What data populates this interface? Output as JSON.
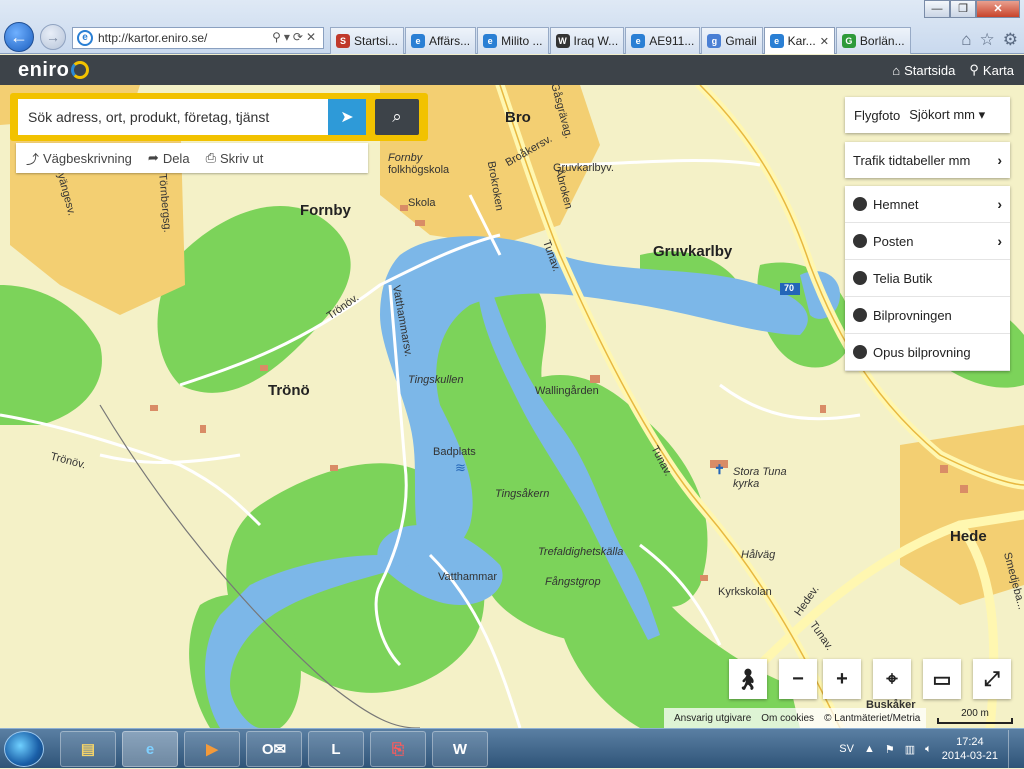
{
  "browser": {
    "url": "http://kartor.eniro.se/",
    "tabs": [
      {
        "label": "Startsi...",
        "color": "#c0392b",
        "icon": "S"
      },
      {
        "label": "Affärs...",
        "color": "#2a7fd4",
        "icon": "e"
      },
      {
        "label": "Milito ...",
        "color": "#2a7fd4",
        "icon": "e"
      },
      {
        "label": "Iraq W...",
        "color": "#333333",
        "icon": "W"
      },
      {
        "label": "AE911...",
        "color": "#2a7fd4",
        "icon": "e"
      },
      {
        "label": "Gmail",
        "color": "#4a7fd4",
        "icon": "g"
      },
      {
        "label": "Kar...",
        "color": "#2a7fd4",
        "icon": "e",
        "active": true
      },
      {
        "label": "Borlän...",
        "color": "#2e9a3a",
        "icon": "G"
      }
    ]
  },
  "eniro": {
    "logo": "eniro",
    "nav_home": "Startsida",
    "nav_map": "Karta"
  },
  "search": {
    "placeholder": "Sök adress, ort, produkt, företag, tjänst"
  },
  "actions": {
    "directions": "Vägbeskrivning",
    "share": "Dela",
    "print": "Skriv ut"
  },
  "layers": {
    "aerial": "Flygfoto",
    "chart": "Sjökort mm",
    "traffic": "Trafik tidtabeller mm"
  },
  "poi_items": [
    {
      "label": "Hemnet",
      "icon": "hemnet-icon",
      "chevron": true
    },
    {
      "label": "Posten",
      "icon": "posten-icon",
      "chevron": true
    },
    {
      "label": "Telia Butik",
      "icon": "telia-icon",
      "chevron": false
    },
    {
      "label": "Bilprovningen",
      "icon": "bilprovningen-icon",
      "chevron": false
    },
    {
      "label": "Opus bilprovning",
      "icon": "opus-icon",
      "chevron": false
    }
  ],
  "map_labels": {
    "bro": "Bro",
    "fornby": "Fornby",
    "gruvkarlby": "Gruvkarlby",
    "trono": "Trönö",
    "hede": "Hede",
    "fornby_folk": "Fornby",
    "fornby_folk2": "folkhögskola",
    "skola": "Skola",
    "tingskullen": "Tingskullen",
    "wallingarden": "Wallingården",
    "badplats": "Badplats",
    "tingsakern": "Tingsåkern",
    "trefaldighet": "Trefaldighetskälla",
    "vatthammar": "Vatthammar",
    "fangstgrop": "Fångstgrop",
    "stora_tuna": "Stora Tuna",
    "kyrka": "kyrka",
    "halvag": "Hålväg",
    "kyrkskolan": "Kyrkskolan",
    "buskaker": "Buskåker",
    "tunav1": "Tunav.",
    "tunav2": "Tunav.",
    "tunav3": "Tunav.",
    "hedev": "Hedev.",
    "vatthammarsv": "Vatthammarsv.",
    "tronov": "Trönöv.",
    "tronov2": "Trönöv.",
    "brokroken": "Brokroken",
    "abroken": "Åbroken",
    "broakersv": "Broåkersv.",
    "gasgrav": "Gåsgrävag.",
    "gruvkarlbyv": "Gruvkarlbyv.",
    "byangesv": "Byängesv.",
    "tornbergsg": "Törnbergsg.",
    "road70": "70",
    "smedjeb": "Smedjeba..."
  },
  "controls": {
    "attribution_1": "Ansvarig utgivare",
    "attribution_2": "Om cookies",
    "attribution_3": "© Lantmäteriet/Metria",
    "scale": "200 m"
  },
  "taskbar": {
    "lang": "SV",
    "time": "17:24",
    "date": "2014-03-21"
  }
}
